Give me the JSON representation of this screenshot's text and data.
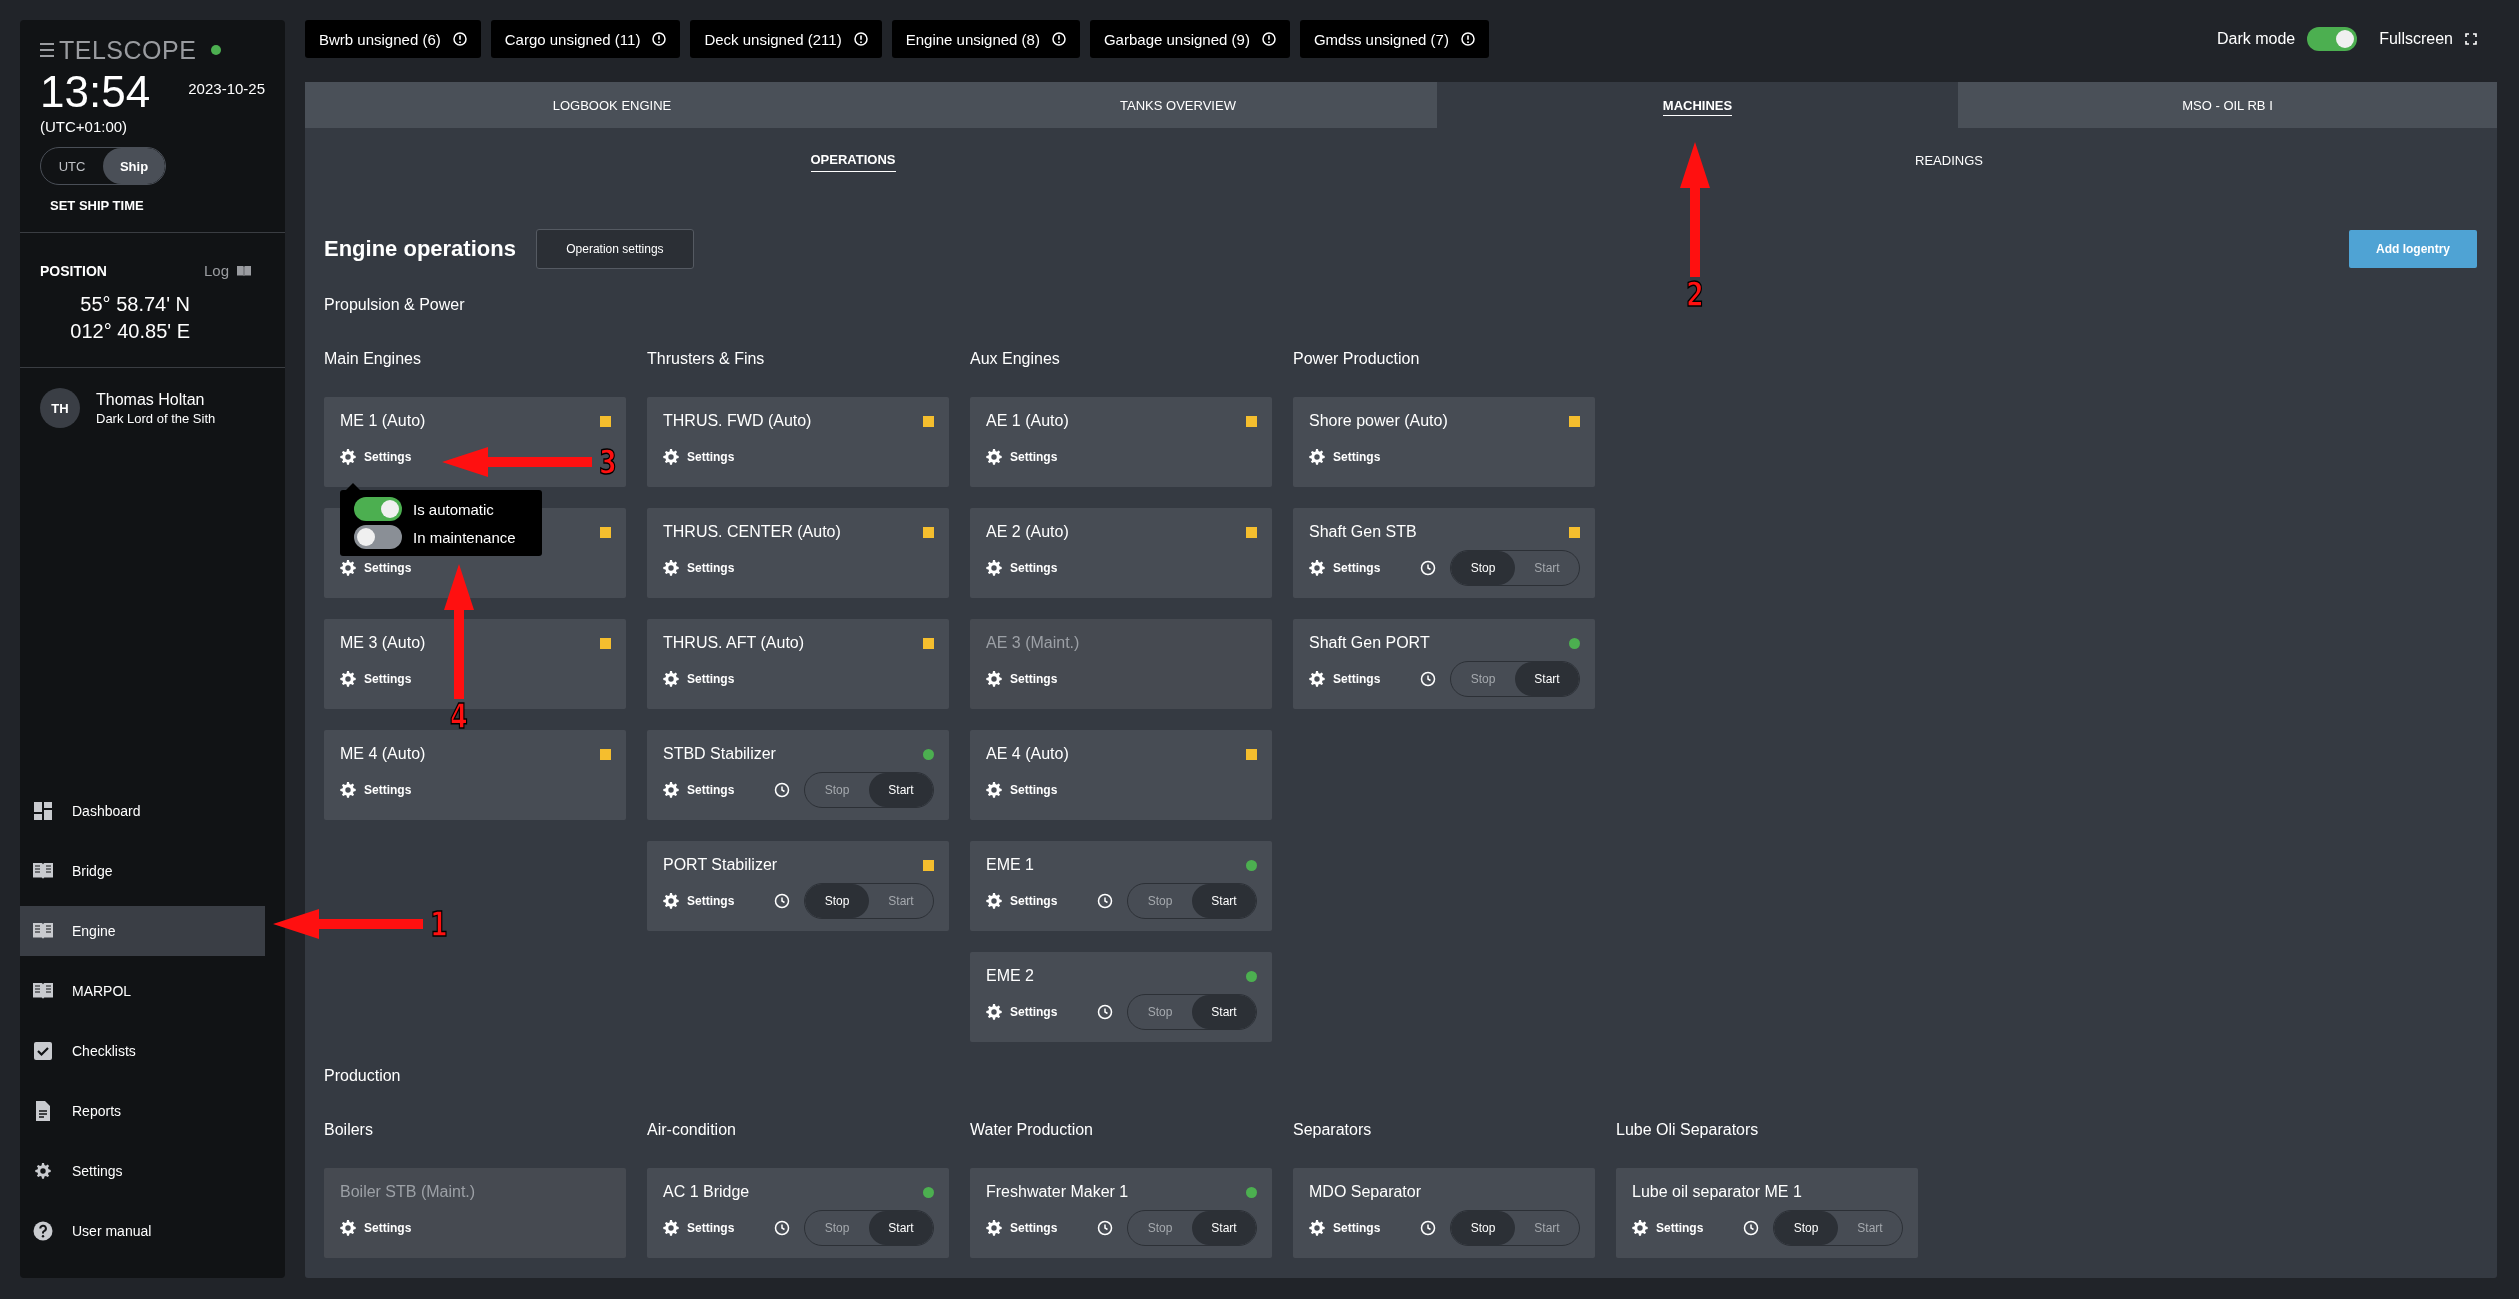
{
  "sidebar": {
    "logo": "TELSCOPE",
    "time": "13:54",
    "date": "2023-10-25",
    "timezone": "(UTC+01:00)",
    "clock_modes": [
      {
        "label": "UTC",
        "selected": false
      },
      {
        "label": "Ship",
        "selected": true
      }
    ],
    "set_time_link": "SET SHIP TIME",
    "position": {
      "title": "POSITION",
      "log_link": "Log",
      "latitude": "55° 58.74' N",
      "longitude": "012° 40.85' E"
    },
    "user": {
      "initials": "TH",
      "name": "Thomas Holtan",
      "role": "Dark Lord of the Sith"
    },
    "nav": [
      {
        "label": "Dashboard",
        "selected": false
      },
      {
        "label": "Bridge",
        "selected": false
      },
      {
        "label": "Engine",
        "selected": true
      },
      {
        "label": "MARPOL",
        "selected": false
      },
      {
        "label": "Checklists",
        "selected": false
      },
      {
        "label": "Reports",
        "selected": false
      },
      {
        "label": "Settings",
        "selected": false
      },
      {
        "label": "User manual",
        "selected": false
      }
    ]
  },
  "unsigned_chips": [
    {
      "label": "Bwrb unsigned (6)"
    },
    {
      "label": "Cargo unsigned (11)"
    },
    {
      "label": "Deck unsigned (211)"
    },
    {
      "label": "Engine unsigned (8)"
    },
    {
      "label": "Garbage unsigned (9)"
    },
    {
      "label": "Gmdss unsigned (7)"
    }
  ],
  "dark_mode": {
    "label": "Dark mode",
    "on": true
  },
  "fullscreen": "Fullscreen",
  "tabs": [
    {
      "label": "LOGBOOK ENGINE",
      "selected": false
    },
    {
      "label": "TANKS OVERVIEW",
      "selected": false
    },
    {
      "label": "MACHINES",
      "selected": true
    },
    {
      "label": "MSO - OIL RB I",
      "selected": false
    }
  ],
  "subtabs": [
    {
      "label": "OPERATIONS",
      "selected": true
    },
    {
      "label": "READINGS",
      "selected": false
    }
  ],
  "header": {
    "title": "Engine operations",
    "settings_button": "Operation settings",
    "add_button": "Add logentry"
  },
  "sections": [
    {
      "title": "Propulsion & Power",
      "groups": [
        {
          "title": "Main Engines",
          "cards": [
            {
              "kind": "basic",
              "name": "ME 1 (Auto)",
              "running": false,
              "disabled": false,
              "settings": "Settings"
            },
            {
              "kind": "basic",
              "running": false,
              "settings": "Settings"
            },
            {
              "kind": "basic",
              "name": "ME 3 (Auto)",
              "running": false,
              "disabled": false,
              "settings": "Settings"
            },
            {
              "kind": "basic",
              "name": "ME 4 (Auto)",
              "running": false,
              "disabled": false,
              "settings": "Settings"
            }
          ]
        },
        {
          "title": "Thrusters & Fins",
          "cards": [
            {
              "kind": "basic",
              "name": "THRUS. FWD (Auto)",
              "running": false,
              "disabled": false,
              "settings": "Settings"
            },
            {
              "kind": "basic",
              "name": "THRUS. CENTER (Auto)",
              "running": false,
              "disabled": false,
              "settings": "Settings"
            },
            {
              "kind": "basic",
              "name": "THRUS. AFT (Auto)",
              "running": false,
              "disabled": false,
              "settings": "Settings"
            },
            {
              "kind": "switch",
              "name": "STBD Stabilizer",
              "running": true,
              "disabled": false,
              "settings": "Settings",
              "switch": [
                {
                  "label": "Stop",
                  "selected": false
                },
                {
                  "label": "Start",
                  "selected": true
                }
              ]
            },
            {
              "kind": "switch",
              "name": "PORT Stabilizer",
              "running": false,
              "disabled": false,
              "settings": "Settings",
              "switch": [
                {
                  "label": "Stop",
                  "selected": true
                },
                {
                  "label": "Start",
                  "selected": false
                }
              ]
            }
          ]
        },
        {
          "title": "Aux Engines",
          "cards": [
            {
              "kind": "basic",
              "name": "AE 1 (Auto)",
              "running": false,
              "disabled": false,
              "settings": "Settings"
            },
            {
              "kind": "basic",
              "name": "AE 2 (Auto)",
              "running": false,
              "disabled": false,
              "settings": "Settings"
            },
            {
              "kind": "basic",
              "name": "AE 3 (Maint.)",
              "disabled": true,
              "settings": "Settings"
            },
            {
              "kind": "basic",
              "name": "AE 4 (Auto)",
              "running": false,
              "disabled": false,
              "settings": "Settings"
            },
            {
              "kind": "switch",
              "name": "EME 1",
              "running": true,
              "disabled": false,
              "settings": "Settings",
              "switch": [
                {
                  "label": "Stop",
                  "selected": false
                },
                {
                  "label": "Start",
                  "selected": true
                }
              ]
            },
            {
              "kind": "switch",
              "name": "EME 2",
              "running": true,
              "disabled": false,
              "settings": "Settings",
              "switch": [
                {
                  "label": "Stop",
                  "selected": false
                },
                {
                  "label": "Start",
                  "selected": true
                }
              ]
            }
          ]
        },
        {
          "title": "Power Production",
          "cards": [
            {
              "kind": "basic",
              "name": "Shore power (Auto)",
              "running": false,
              "disabled": false,
              "settings": "Settings"
            },
            {
              "kind": "switch",
              "name": "Shaft Gen STB",
              "running": false,
              "disabled": false,
              "settings": "Settings",
              "switch": [
                {
                  "label": "Stop",
                  "selected": true
                },
                {
                  "label": "Start",
                  "selected": false
                }
              ]
            },
            {
              "kind": "switch",
              "name": "Shaft Gen PORT",
              "running": true,
              "disabled": false,
              "settings": "Settings",
              "switch": [
                {
                  "label": "Stop",
                  "selected": false
                },
                {
                  "label": "Start",
                  "selected": true
                }
              ]
            }
          ]
        }
      ]
    },
    {
      "title": "Production",
      "groups": [
        {
          "title": "Boilers",
          "cards": [
            {
              "kind": "basic",
              "name": "Boiler STB (Maint.)",
              "disabled": true,
              "settings": "Settings"
            }
          ]
        },
        {
          "title": "Air-condition",
          "cards": [
            {
              "kind": "switch",
              "name": "AC 1 Bridge",
              "running": true,
              "disabled": false,
              "settings": "Settings",
              "switch": [
                {
                  "label": "Stop",
                  "selected": false
                },
                {
                  "label": "Start",
                  "selected": true
                }
              ]
            }
          ]
        },
        {
          "title": "Water Production",
          "cards": [
            {
              "kind": "switch",
              "name": "Freshwater Maker 1",
              "running": true,
              "disabled": false,
              "settings": "Settings",
              "switch": [
                {
                  "label": "Stop",
                  "selected": false
                },
                {
                  "label": "Start",
                  "selected": true
                }
              ]
            }
          ]
        },
        {
          "title": "Separators",
          "cards": [
            {
              "kind": "switch",
              "name": "MDO Separator",
              "disabled": false,
              "settings": "Settings",
              "switch": [
                {
                  "label": "Stop",
                  "selected": true
                },
                {
                  "label": "Start",
                  "selected": false
                }
              ]
            }
          ]
        },
        {
          "title": "Lube Oli Separators",
          "cards": [
            {
              "kind": "switch",
              "name": "Lube oil separator ME 1",
              "disabled": false,
              "settings": "Settings",
              "switch": [
                {
                  "label": "Stop",
                  "selected": true
                },
                {
                  "label": "Start",
                  "selected": false
                }
              ]
            }
          ]
        }
      ]
    }
  ],
  "settings_popover": {
    "toggles": [
      {
        "label": "Is automatic",
        "on": true
      },
      {
        "label": "In maintenance",
        "on": false
      }
    ]
  },
  "annotations": [
    {
      "label": "1",
      "kind": "left"
    },
    {
      "label": "2",
      "kind": "up"
    },
    {
      "label": "3",
      "kind": "left"
    },
    {
      "label": "4",
      "kind": "up"
    }
  ]
}
